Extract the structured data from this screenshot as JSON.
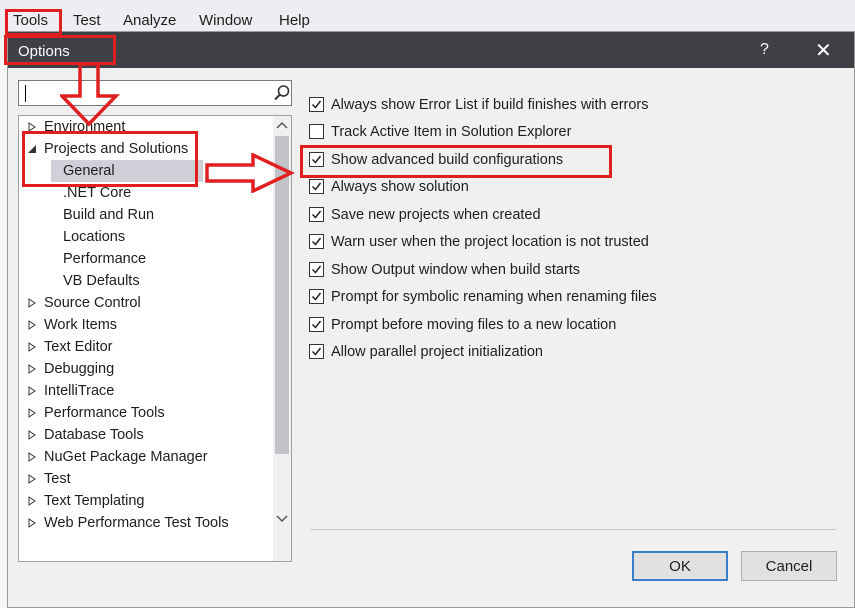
{
  "menubar": {
    "items": [
      "Tools",
      "Test",
      "Analyze",
      "Window",
      "Help"
    ]
  },
  "dialog": {
    "title": "Options",
    "help_label": "?",
    "close_label": "✕",
    "search": {
      "value": "",
      "placeholder": ""
    },
    "tree": [
      {
        "label": "Environment",
        "expanded": false
      },
      {
        "label": "Projects and Solutions",
        "expanded": true
      },
      {
        "label": "General",
        "selected": true
      },
      {
        "label": ".NET Core"
      },
      {
        "label": "Build and Run"
      },
      {
        "label": "Locations"
      },
      {
        "label": "Performance"
      },
      {
        "label": "VB Defaults"
      },
      {
        "label": "Source Control",
        "expanded": false
      },
      {
        "label": "Work Items",
        "expanded": false
      },
      {
        "label": "Text Editor",
        "expanded": false
      },
      {
        "label": "Debugging",
        "expanded": false
      },
      {
        "label": "IntelliTrace",
        "expanded": false
      },
      {
        "label": "Performance Tools",
        "expanded": false
      },
      {
        "label": "Database Tools",
        "expanded": false
      },
      {
        "label": "NuGet Package Manager",
        "expanded": false
      },
      {
        "label": "Test",
        "expanded": false
      },
      {
        "label": "Text Templating",
        "expanded": false
      },
      {
        "label": "Web Performance Test Tools",
        "expanded": false
      }
    ],
    "options": [
      {
        "label": "Always show Error List if build finishes with errors",
        "checked": true
      },
      {
        "label": "Track Active Item in Solution Explorer",
        "checked": false
      },
      {
        "label": "Show advanced build configurations",
        "checked": true
      },
      {
        "label": "Always show solution",
        "checked": true
      },
      {
        "label": "Save new projects when created",
        "checked": true
      },
      {
        "label": "Warn user when the project location is not trusted",
        "checked": true
      },
      {
        "label": "Show Output window when build starts",
        "checked": true
      },
      {
        "label": "Prompt for symbolic renaming when renaming files",
        "checked": true
      },
      {
        "label": "Prompt before moving files to a new location",
        "checked": true
      },
      {
        "label": "Allow parallel project initialization",
        "checked": true
      }
    ],
    "buttons": {
      "ok": "OK",
      "cancel": "Cancel"
    }
  },
  "colors": {
    "titlebar": "#3f3f46",
    "annotation_red": "#e02020",
    "selection": "#cfd0d8",
    "default_button_border": "#3c7fc9"
  }
}
